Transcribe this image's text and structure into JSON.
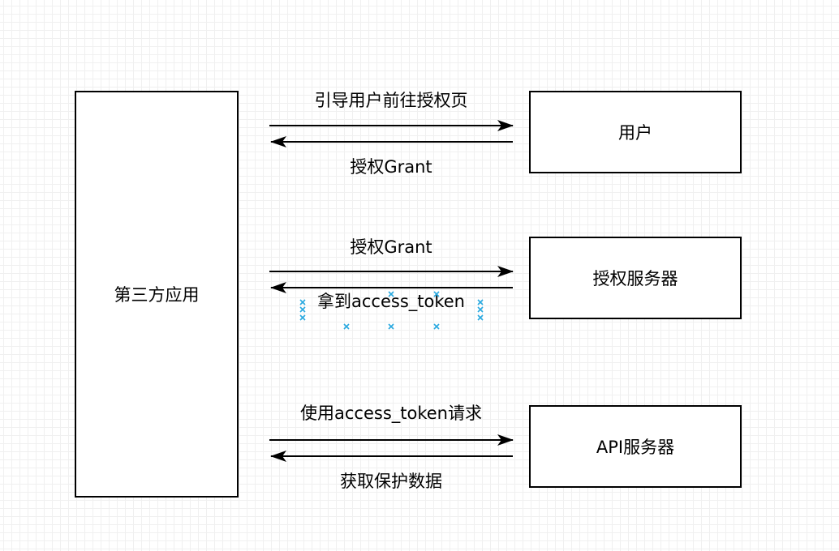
{
  "nodes": {
    "client": "第三方应用",
    "user": "用户",
    "auth_server": "授权服务器",
    "api_server": "API服务器"
  },
  "edges": {
    "redirect_to_auth": "引导用户前往授权页",
    "grant_returned": "授权Grant",
    "grant_sent": "授权Grant",
    "get_token": "拿到access_token",
    "request_with_token": "使用access_token请求",
    "get_protected_data": "获取保护数据"
  },
  "colors": {
    "stroke": "#000000",
    "selection_handle": "#29a9e0",
    "grid": "#e4e4e4"
  }
}
